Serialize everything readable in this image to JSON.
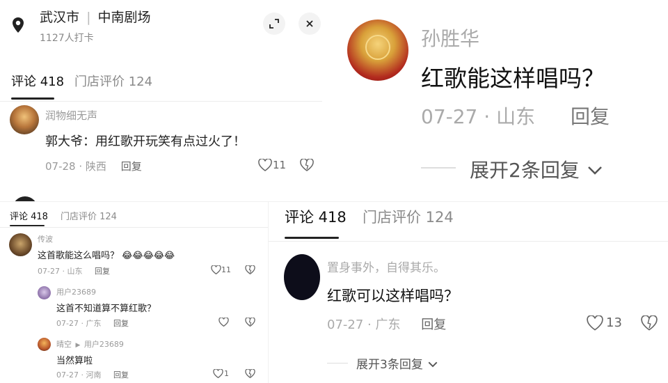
{
  "panel_a": {
    "location": {
      "city": "武汉市",
      "venue": "中南剧场",
      "checkins": "1127人打卡"
    },
    "tabs": [
      {
        "label": "评论 418"
      },
      {
        "label": "门店评价 124"
      }
    ],
    "comment": {
      "username": "润物细无声",
      "text": "郭大爷：用红歌开玩笑有点过火了！",
      "date": "07-28",
      "region": "陕西",
      "reply_label": "回复",
      "like_count": "11"
    }
  },
  "panel_b": {
    "comment": {
      "username": "孙胜华",
      "text": "红歌能这样唱吗？",
      "date": "07-27",
      "region": "山东",
      "reply_label": "回复",
      "expand_label": "展开2条回复"
    }
  },
  "panel_c": {
    "tabs": [
      {
        "label": "评论 418"
      },
      {
        "label": "门店评价 124"
      }
    ],
    "comments": [
      {
        "username": "传波",
        "text": "这首歌能这么唱吗？",
        "date": "07-27",
        "region": "山东",
        "reply_label": "回复",
        "like_count": "11",
        "emojis": [
          "😂",
          "😂",
          "😂",
          "😂",
          "😂"
        ]
      },
      {
        "username": "用户23689",
        "text": "这首不知道算不算红歌？",
        "date": "07-27",
        "region": "广东",
        "reply_label": "回复",
        "like_count": ""
      },
      {
        "username": "晴空",
        "reply_to": "用户23689",
        "text": "当然算啦",
        "date": "07-27",
        "region": "河南",
        "reply_label": "回复",
        "like_count": "1"
      }
    ]
  },
  "panel_d": {
    "tabs": [
      {
        "label": "评论 418"
      },
      {
        "label": "门店评价 124"
      }
    ],
    "comment": {
      "username": "置身事外，自得其乐。",
      "text": "红歌可以这样唱吗？",
      "date": "07-27",
      "region": "广东",
      "reply_label": "回复",
      "like_count": "13",
      "expand_label": "展开3条回复"
    }
  },
  "colors": {
    "muted": "#9a9a9a",
    "text": "#222222",
    "divider": "#ececec"
  }
}
